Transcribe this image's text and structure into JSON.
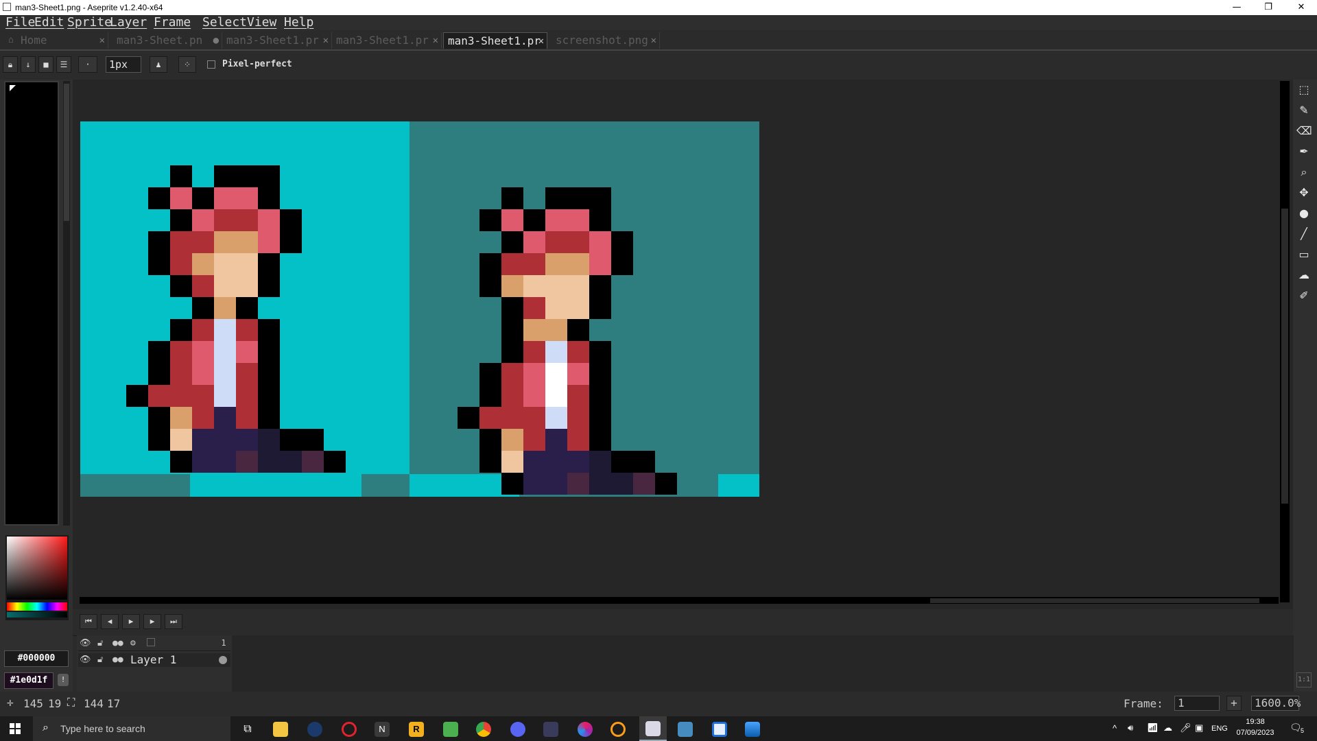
{
  "window": {
    "title": "man3-Sheet1.png - Aseprite v1.2.40-x64"
  },
  "menu": [
    "File",
    "Edit",
    "Sprite",
    "Layer",
    "Frame",
    "Select",
    "View",
    "Help"
  ],
  "tabs": [
    {
      "label": "Home",
      "close": "✕"
    },
    {
      "label": "man3-Sheet.pn",
      "close": "●"
    },
    {
      "label": "man3-Sheet1.pr",
      "close": "✕"
    },
    {
      "label": "man3-Sheet1.pr",
      "close": "✕"
    },
    {
      "label": "man3-Sheet1.pr",
      "close": "✕"
    },
    {
      "label": "screenshot.png",
      "close": "✕"
    }
  ],
  "toolbar": {
    "brush_size": "1px",
    "pixel_perfect_label": "Pixel-perfect",
    "pixel_perfect_checked": false
  },
  "colors": {
    "foreground": "#000000",
    "background": "#1e0d1f",
    "canvas_bg_left": "#03c1c6",
    "canvas_bg_right": "#2e7e80"
  },
  "layers": {
    "frame_header": "1",
    "items": [
      {
        "name": "Layer 1"
      }
    ]
  },
  "status": {
    "cursor_x": "145",
    "cursor_y": "19",
    "size_w": "144",
    "size_h": "17",
    "frame_label": "Frame:",
    "frame_value": "1",
    "zoom": "1600.0%"
  },
  "taskbar": {
    "search_placeholder": "Type here to search",
    "language": "ENG",
    "time": "19:38",
    "date": "07/09/2023",
    "notifications": "5"
  },
  "icons": [
    "windows-icon",
    "search-icon",
    "task-view-icon",
    "file-explorer-icon",
    "steam-icon",
    "opera-icon",
    "notion-icon",
    "rockstar-icon",
    "minecraft-icon",
    "chrome-icon",
    "discord-icon",
    "davinci-icon",
    "app-icon",
    "overwatch-icon",
    "twitch-icon",
    "godot-icon",
    "window-app-icon",
    "photos-icon"
  ]
}
